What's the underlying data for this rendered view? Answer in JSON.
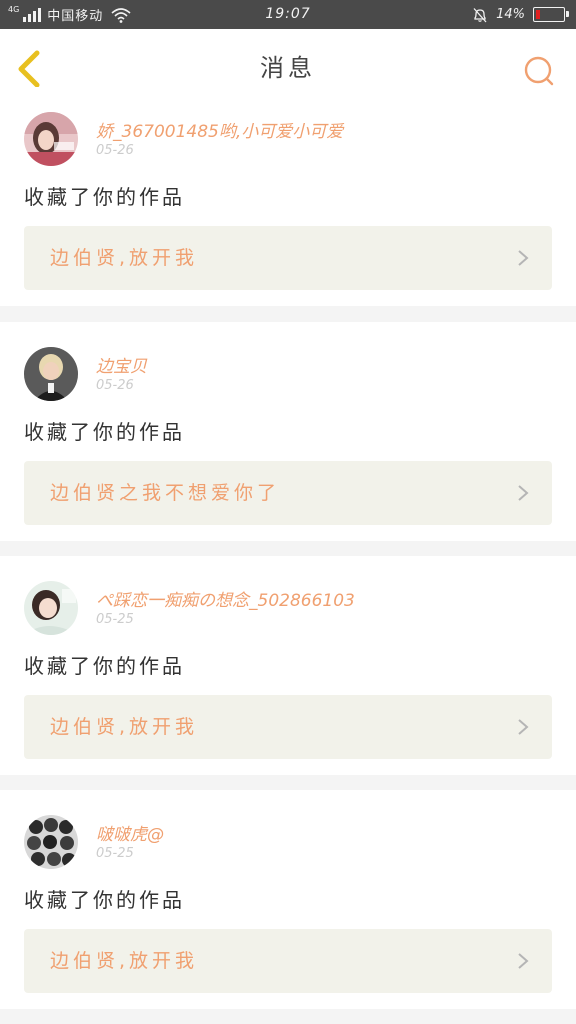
{
  "status_bar": {
    "network": "4G",
    "carrier": "中国移动",
    "time": "19:07",
    "battery_percent": "14%",
    "battery_level": 0.14,
    "icons": [
      "signal-icon",
      "wifi-icon",
      "bell-muted-icon",
      "battery-icon"
    ]
  },
  "nav": {
    "title": "消息",
    "back_icon": "chevron-left-icon",
    "search_icon": "search-icon",
    "accent_color": "#f0a070",
    "back_color": "#e8c020"
  },
  "messages": [
    {
      "username": "娇_367001485哟,小可爱小可爱",
      "date": "05-26",
      "action": "收藏了你的作品",
      "work_title": "边伯贤,放开我"
    },
    {
      "username": "边宝贝",
      "date": "05-26",
      "action": "收藏了你的作品",
      "work_title": "边伯贤之我不想爱你了"
    },
    {
      "username": "ぺ踩恋一痴痴の想念_502866103",
      "date": "05-25",
      "action": "收藏了你的作品",
      "work_title": "边伯贤,放开我"
    },
    {
      "username": "啵啵虎@",
      "date": "05-25",
      "action": "收藏了你的作品",
      "work_title": "边伯贤,放开我"
    }
  ]
}
